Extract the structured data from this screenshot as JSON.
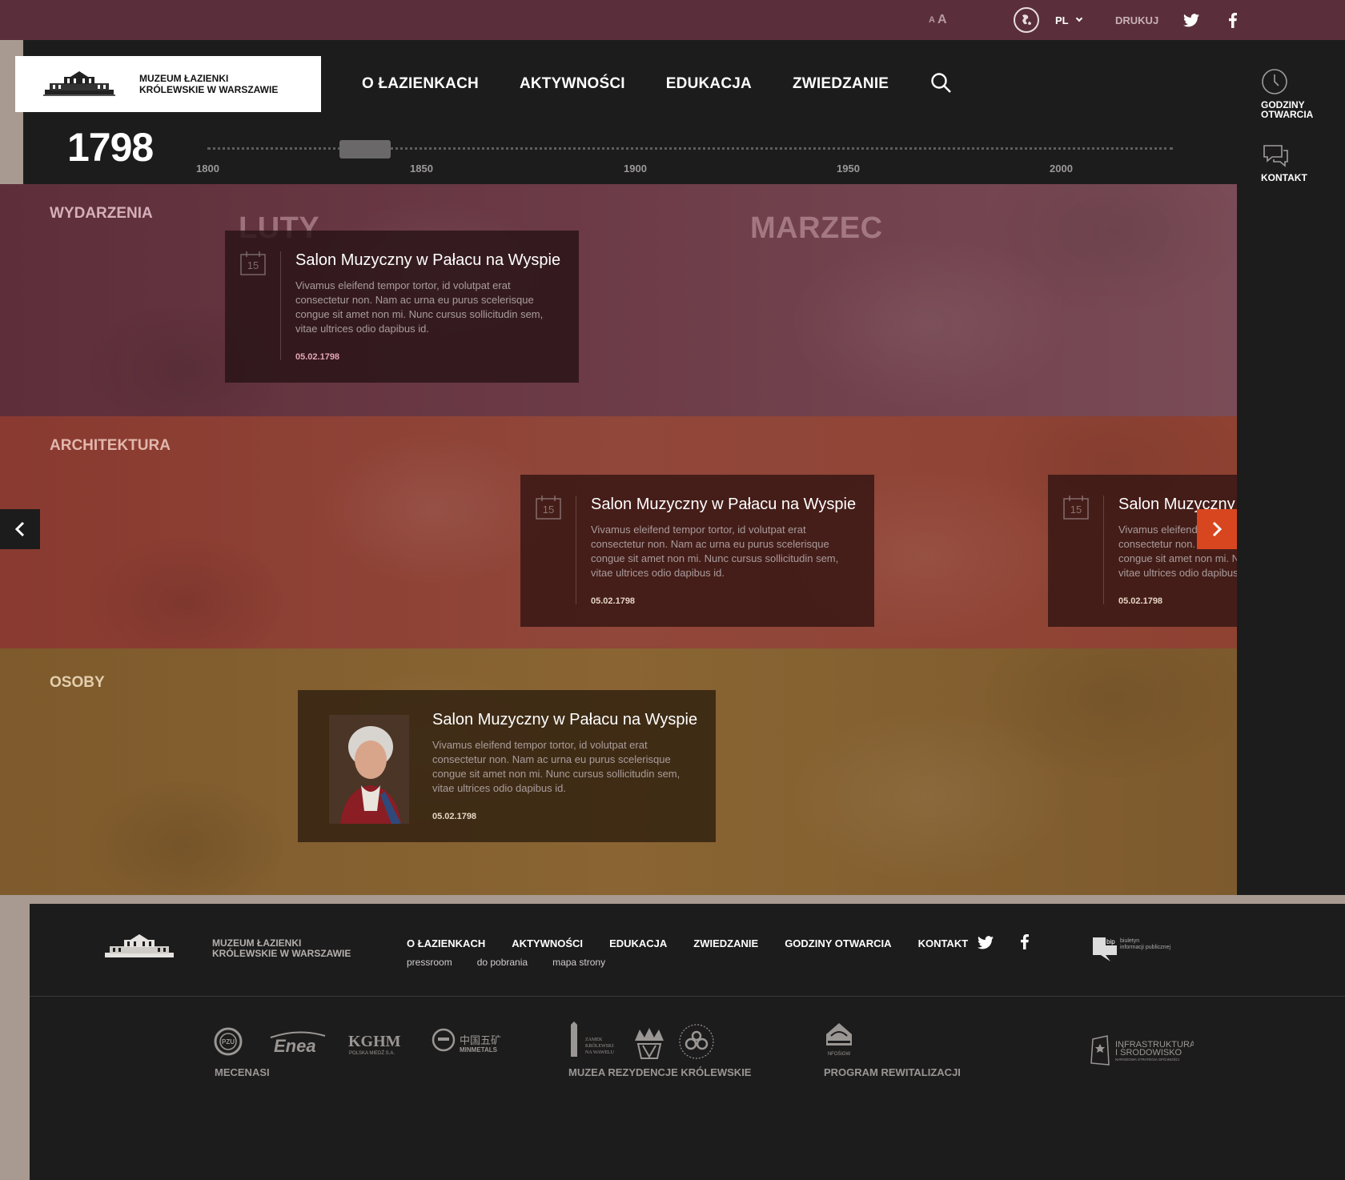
{
  "topbar": {
    "font_small": "A",
    "font_large": "A",
    "language": "PL",
    "print": "DRUKUJ"
  },
  "header": {
    "logo_line1": "MUZEUM ŁAZIENKI",
    "logo_line2": "KRÓLEWSKIE W WARSZAWIE",
    "nav": [
      "O ŁAZIENKACH",
      "AKTYWNOŚCI",
      "EDUKACJA",
      "ZWIEDZANIE"
    ]
  },
  "side": {
    "hours_line1": "GODZINY",
    "hours_line2": "OTWARCIA",
    "contact": "KONTAKT"
  },
  "timeline": {
    "current_year": "1798",
    "ticks": [
      "1800",
      "1850",
      "1900",
      "1950",
      "2000"
    ]
  },
  "bands": {
    "wydarzenia": {
      "label": "WYDARZENIA",
      "months": [
        "LUTY",
        "MARZEC"
      ],
      "cards": [
        {
          "day": "15",
          "title": "Salon Muzyczny w Pałacu na Wyspie",
          "desc": "Vivamus eleifend tempor tortor, id volutpat erat consectetur non. Nam ac urna eu purus scelerisque congue sit amet non mi. Nunc cursus sollicitudin sem, vitae ultrices odio dapibus id.",
          "date": "05.02.1798"
        }
      ]
    },
    "architektura": {
      "label": "ARCHITEKTURA",
      "cards": [
        {
          "day": "15",
          "title": "Salon Muzyczny w Pałacu na Wyspie",
          "desc": "Vivamus eleifend tempor tortor, id volutpat erat consectetur non. Nam ac urna eu purus scelerisque congue sit amet non mi. Nunc cursus sollicitudin sem, vitae ultrices odio dapibus id.",
          "date": "05.02.1798"
        },
        {
          "day": "15",
          "title": "Salon Muzyczny w Pałacu na Wyspie",
          "desc": "Vivamus eleifend tempor tortor, id volutpat erat consectetur non. Nam ac urna eu purus scelerisque congue sit amet non mi. Nunc cursus sollicitudin sem, vitae ultrices odio dapibus id.",
          "date": "05.02.1798"
        }
      ]
    },
    "osoby": {
      "label": "OSOBY",
      "cards": [
        {
          "title": "Salon Muzyczny w Pałacu na Wyspie",
          "desc": "Vivamus eleifend tempor tortor, id volutpat erat consectetur non. Nam ac urna eu purus scelerisque congue sit amet non mi. Nunc cursus sollicitudin sem, vitae ultrices odio dapibus id.",
          "date": "05.02.1798"
        }
      ]
    }
  },
  "footer": {
    "logo_line1": "MUZEUM ŁAZIENKI",
    "logo_line2": "KRÓLEWSKIE W WARSZAWIE",
    "nav": [
      "O ŁAZIENKACH",
      "AKTYWNOŚCI",
      "EDUKACJA",
      "ZWIEDZANIE",
      "GODZINY OTWARCIA",
      "KONTAKT"
    ],
    "sub": [
      "pressroom",
      "do pobrania",
      "mapa strony"
    ],
    "bip_line1": "biuletyn",
    "bip_line2": "informacji publicznej",
    "sponsors": {
      "mecenasi": "MECENASI",
      "muzea": "MUZEA REZYDENCJE KRÓLEWSKIE",
      "program": "PROGRAM REWITALIZACJI"
    },
    "logos": {
      "pzu": "PZU",
      "enea": "Enea",
      "kghm": "KGHM",
      "kghm_sub": "POLSKA MIEDŹ S.A.",
      "minmetals_cn": "中国五矿",
      "minmetals": "MINMETALS",
      "wawel_line1": "ZAMEK",
      "wawel_line2": "KRÓLEWSKI",
      "wawel_line3": "NA WAWELU",
      "nfosigw": "NFOŚiGW",
      "infra_line1": "INFRASTRUKTURA",
      "infra_line2": "I ŚRODOWISKO",
      "infra_line3": "NARODOWA STRATEGIA SPÓJNOŚCI"
    }
  }
}
